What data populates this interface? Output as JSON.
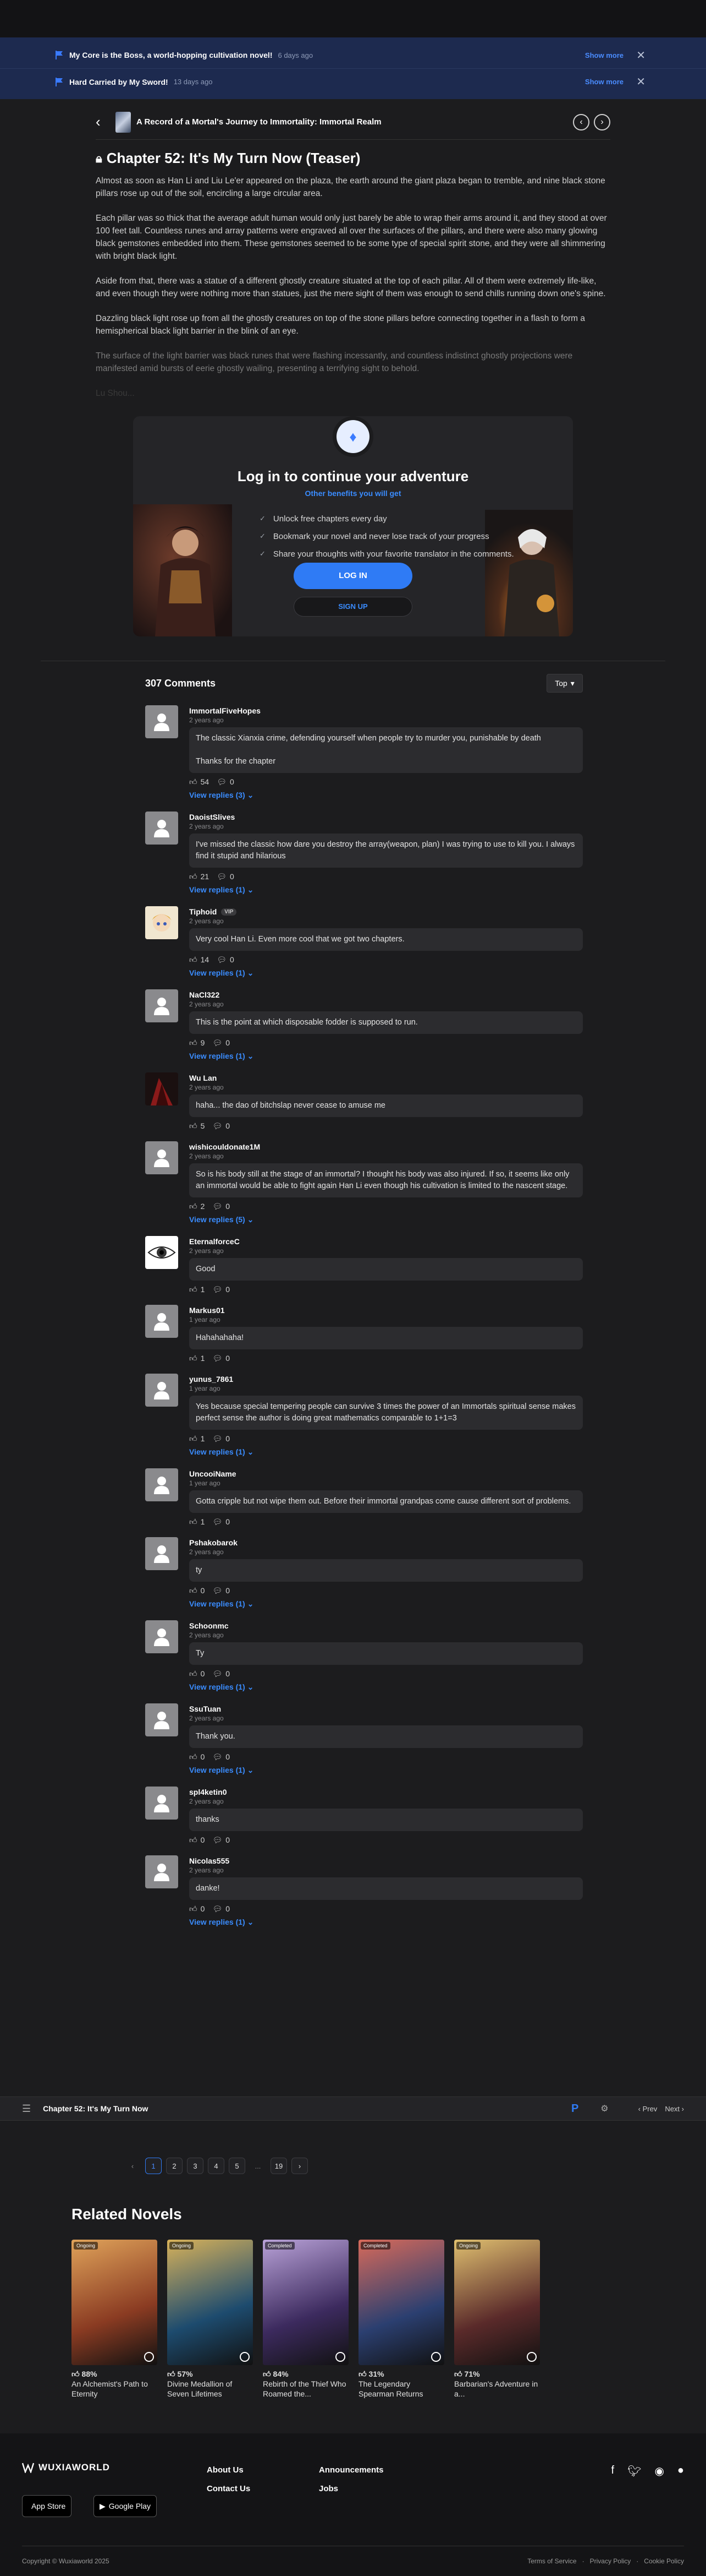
{
  "notifications": [
    {
      "title": "My Core is the Boss, a world-hopping cultivation novel!",
      "time": "6 days ago",
      "action": "Show more"
    },
    {
      "title": "Hard Carried by My Sword!",
      "time": "13 days ago",
      "action": "Show more"
    }
  ],
  "breadcrumb": {
    "novel_title": "A Record of a Mortal's Journey to Immortality: Immortal Realm"
  },
  "chapter": {
    "title": "Chapter 52: It's My Turn Now (Teaser)",
    "paragraphs": [
      "Almost as soon as Han Li and Liu Le'er appeared on the plaza, the earth around the giant plaza began to tremble, and nine black stone pillars rose up out of the soil, encircling a large circular area.",
      "Each pillar was so thick that the average adult human would only just barely be able to wrap their arms around it, and they stood at over 100 feet tall. Countless runes and array patterns were engraved all over the surfaces of the pillars, and there were also many glowing black gemstones embedded into them. These gemstones seemed to be some type of special spirit stone, and they were all shimmering with bright black light.",
      "Aside from that, there was a statue of a different ghostly creature situated at the top of each pillar. All of them were extremely life-like, and even though they were nothing more than statues, just the mere sight of them was enough to send chills running down one's spine.",
      "Dazzling black light rose up from all the ghostly creatures on top of the stone pillars before connecting together in a flash to form a hemispherical black light barrier in the blink of an eye.",
      "The surface of the light barrier was black runes that were flashing incessantly, and countless indistinct ghostly projections were manifested amid bursts of eerie ghostly wailing, presenting a terrifying sight to behold.",
      "Lu Shou..."
    ]
  },
  "login": {
    "title": "Log in to continue your adventure",
    "subtitle": "Other benefits you will get",
    "benefits": [
      "Unlock free chapters every day",
      "Bookmark your novel and never lose track of your progress",
      "Share your thoughts with your favorite translator in the comments."
    ],
    "login_label": "LOG IN",
    "signup_label": "SIGN UP"
  },
  "comments_header": {
    "count_label": "307 Comments",
    "sort_label": "Top"
  },
  "comments": [
    {
      "user": "ImmortalFiveHopes",
      "time": "2 years ago",
      "body": [
        "The classic Xianxia crime, defending yourself when people try to murder you, punishable by death",
        "Thanks for the chapter"
      ],
      "likes": "54",
      "dislikes": "0",
      "replies": "View replies (3)",
      "avatar": "default"
    },
    {
      "user": "DaoistSlives",
      "time": "2 years ago",
      "body": [
        "I've missed the classic how dare you destroy the array(weapon, plan) I was trying to use to kill you. I always find it stupid and hilarious"
      ],
      "likes": "21",
      "dislikes": "0",
      "replies": "View replies (1)",
      "avatar": "default"
    },
    {
      "user": "Tiphoid",
      "vip": "VIP",
      "time": "2 years ago",
      "body": [
        "Very cool Han Li. Even more cool that we got two chapters."
      ],
      "likes": "14",
      "dislikes": "0",
      "replies": "View replies (1)",
      "avatar": "anime"
    },
    {
      "user": "NaCl322",
      "time": "2 years ago",
      "body": [
        "This is the point at which disposable fodder is supposed to run."
      ],
      "likes": "9",
      "dislikes": "0",
      "replies": "View replies (1)",
      "avatar": "default"
    },
    {
      "user": "Wu Lan",
      "time": "2 years ago",
      "body": [
        "haha... the dao of bitchslap never cease to amuse me"
      ],
      "likes": "5",
      "dislikes": "0",
      "replies": "",
      "avatar": "dark"
    },
    {
      "user": "wishicouldonate1M",
      "time": "2 years ago",
      "body": [
        "So is his body still at the stage of an immortal? I thought his body was also injured. If so, it seems like only an immortal would be able to fight again Han Li even though his cultivation is limited to the nascent stage."
      ],
      "likes": "2",
      "dislikes": "0",
      "replies": "View replies (5)",
      "avatar": "default"
    },
    {
      "user": "EternalforceC",
      "time": "2 years ago",
      "body": [
        "Good"
      ],
      "likes": "1",
      "dislikes": "0",
      "replies": "",
      "avatar": "eye"
    },
    {
      "user": "Markus01",
      "time": "1 year ago",
      "body": [
        "Hahahahaha!"
      ],
      "likes": "1",
      "dislikes": "0",
      "replies": "",
      "avatar": "default"
    },
    {
      "user": "yunus_7861",
      "time": "1 year ago",
      "body": [
        "Yes because special tempering people can survive 3 times the power of an Immortals spiritual sense makes perfect sense the author is doing great mathematics comparable to 1+1=3"
      ],
      "likes": "1",
      "dislikes": "0",
      "replies": "View replies (1)",
      "avatar": "default"
    },
    {
      "user": "UncooiName",
      "time": "1 year ago",
      "body": [
        "Gotta cripple but not wipe them out. Before their immortal grandpas come cause different sort of problems."
      ],
      "likes": "1",
      "dislikes": "0",
      "replies": "",
      "avatar": "default"
    },
    {
      "user": "Pshakobarok",
      "time": "2 years ago",
      "body": [
        "ty"
      ],
      "likes": "0",
      "dislikes": "0",
      "replies": "View replies (1)",
      "avatar": "default"
    },
    {
      "user": "Schoonmc",
      "time": "2 years ago",
      "body": [
        "Ty"
      ],
      "likes": "0",
      "dislikes": "0",
      "replies": "View replies (1)",
      "avatar": "default"
    },
    {
      "user": "SsuTuan",
      "time": "2 years ago",
      "body": [
        "Thank you."
      ],
      "likes": "0",
      "dislikes": "0",
      "replies": "View replies (1)",
      "avatar": "default"
    },
    {
      "user": "spl4ketin0",
      "time": "2 years ago",
      "body": [
        "thanks"
      ],
      "likes": "0",
      "dislikes": "0",
      "replies": "",
      "avatar": "default"
    },
    {
      "user": "Nicolas555",
      "time": "2 years ago",
      "body": [
        "danke!"
      ],
      "likes": "0",
      "dislikes": "0",
      "replies": "View replies (1)",
      "avatar": "default"
    }
  ],
  "bottom_nav": {
    "title": "Chapter 52: It's My Turn Now",
    "p_label": "P",
    "prev_label": "Prev",
    "next_label": "Next"
  },
  "pagination": {
    "pages": [
      "1",
      "2",
      "3",
      "4",
      "5",
      "...",
      "19"
    ],
    "active": "1"
  },
  "related": {
    "title": "Related Novels",
    "novels": [
      {
        "badge": "Ongoing",
        "rating": "88%",
        "name": "An Alchemist's Path to Eternity",
        "color_a": "#8a3b22",
        "color_b": "#e0a35a"
      },
      {
        "badge": "Ongoing",
        "rating": "57%",
        "name": "Divine Medallion of Seven Lifetimes",
        "color_a": "#1d4b6e",
        "color_b": "#d8b25a"
      },
      {
        "badge": "Completed",
        "rating": "84%",
        "name": "Rebirth of the Thief Who Roamed the...",
        "color_a": "#3c2a5e",
        "color_b": "#b9a2d8"
      },
      {
        "badge": "Completed",
        "rating": "31%",
        "name": "The Legendary Spearman Returns",
        "color_a": "#2b3f70",
        "color_b": "#d86a5a"
      },
      {
        "badge": "Ongoing",
        "rating": "71%",
        "name": "Barbarian's Adventure in a...",
        "color_a": "#5a2a2a",
        "color_b": "#e0c070"
      }
    ]
  },
  "footer": {
    "logo": "WUXIAWORLD",
    "app_store": "App Store",
    "google_play": "Google Play",
    "links": [
      "About Us",
      "Contact Us",
      "Announcements",
      "Jobs"
    ],
    "copyright": "Copyright © Wuxiaworld 2025",
    "legal": [
      "Terms of Service",
      "·",
      "Privacy Policy",
      "·",
      "Cookie Policy"
    ]
  }
}
